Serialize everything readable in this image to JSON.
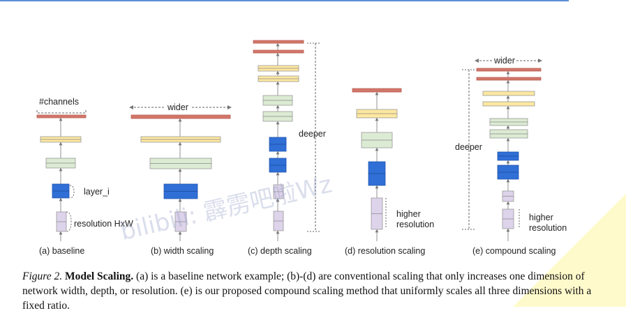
{
  "figure": {
    "labels": {
      "channels": "#channels",
      "layer": "layer_i",
      "resolution": "resolution HxW",
      "wider": "wider",
      "deeper": "deeper",
      "higher_resolution_1": "higher",
      "higher_resolution_2": "resolution"
    },
    "panels": [
      {
        "id": "a",
        "caption": "(a) baseline"
      },
      {
        "id": "b",
        "caption": "(b) width scaling"
      },
      {
        "id": "c",
        "caption": "(c) depth scaling"
      },
      {
        "id": "d",
        "caption": "(d) resolution scaling"
      },
      {
        "id": "e",
        "caption": "(e) compound scaling"
      }
    ],
    "colors": {
      "red": "#d2766a",
      "yellow": "#fde8a0",
      "green": "#dcebd3",
      "blue": "#2f6fd6",
      "purple": "#ddd3ea",
      "stroke": "#777777"
    }
  },
  "caption": {
    "figure_number": "Figure 2.",
    "title": "Model Scaling.",
    "text": "(a) is a baseline network example; (b)-(d) are conventional scaling that only increases one dimension of network width, depth, or resolution. (e) is our proposed compound scaling method that uniformly scales all three dimensions with a fixed ratio."
  },
  "watermark": "bilibili: 霹雳吧啦Wz"
}
